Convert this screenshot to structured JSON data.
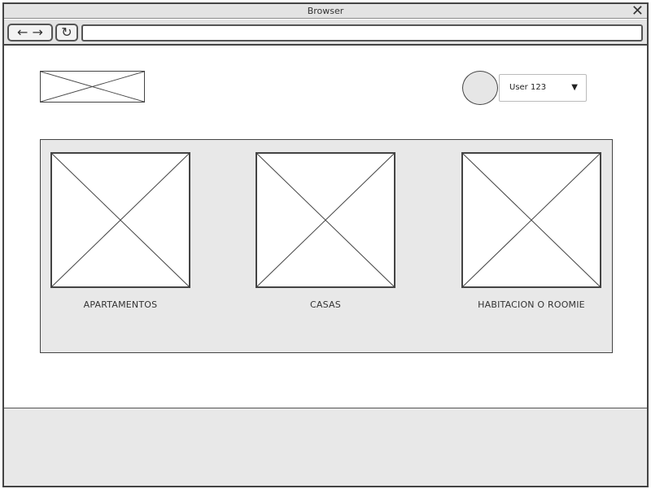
{
  "window": {
    "title": "Browser",
    "close_glyph": "✕",
    "back_forward_glyph": "← →",
    "reload_glyph": "↻",
    "url": ""
  },
  "header": {
    "logo_icon": "image-placeholder-icon",
    "user": {
      "name": "User 123",
      "caret": "▼"
    }
  },
  "categories": [
    {
      "label": "APARTAMENTOS",
      "icon": "image-placeholder-icon"
    },
    {
      "label": "CASAS",
      "icon": "image-placeholder-icon"
    },
    {
      "label": "HABITACION O ROOMIE",
      "icon": "image-placeholder-icon"
    }
  ],
  "colors": {
    "panel": "#e8e8e8",
    "border": "#444444",
    "chrome": "#e3e3e3"
  }
}
